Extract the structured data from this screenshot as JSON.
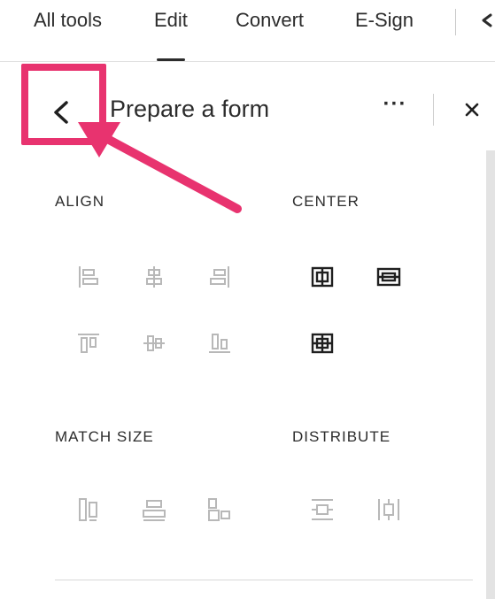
{
  "nav": {
    "tabs": [
      {
        "label": "All tools",
        "active": false
      },
      {
        "label": "Edit",
        "active": true
      },
      {
        "label": "Convert",
        "active": false
      },
      {
        "label": "E-Sign",
        "active": false
      }
    ]
  },
  "panel": {
    "title": "Prepare a form",
    "back_icon": "chevron-left-icon",
    "more_icon": "more-horizontal-icon",
    "more_label": "···",
    "close_icon": "close-icon"
  },
  "annotation": {
    "highlight_color": "#e8336f",
    "target": "back-button"
  },
  "sections": {
    "align": {
      "label": "ALIGN",
      "tools": [
        {
          "icon": "align-left-icon",
          "enabled": false
        },
        {
          "icon": "align-center-horizontal-icon",
          "enabled": false
        },
        {
          "icon": "align-right-icon",
          "enabled": false
        },
        {
          "icon": "align-top-icon",
          "enabled": false
        },
        {
          "icon": "align-center-vertical-icon",
          "enabled": false
        },
        {
          "icon": "align-bottom-icon",
          "enabled": false
        }
      ]
    },
    "center": {
      "label": "CENTER",
      "tools": [
        {
          "icon": "center-horizontal-icon",
          "enabled": true
        },
        {
          "icon": "center-vertical-icon",
          "enabled": true
        },
        {
          "icon": "center-both-icon",
          "enabled": true
        }
      ]
    },
    "match_size": {
      "label": "MATCH SIZE",
      "tools": [
        {
          "icon": "match-height-icon",
          "enabled": false
        },
        {
          "icon": "match-width-icon",
          "enabled": false
        },
        {
          "icon": "match-both-icon",
          "enabled": false
        }
      ]
    },
    "distribute": {
      "label": "DISTRIBUTE",
      "tools": [
        {
          "icon": "distribute-vertical-icon",
          "enabled": false
        },
        {
          "icon": "distribute-horizontal-icon",
          "enabled": false
        }
      ]
    }
  }
}
